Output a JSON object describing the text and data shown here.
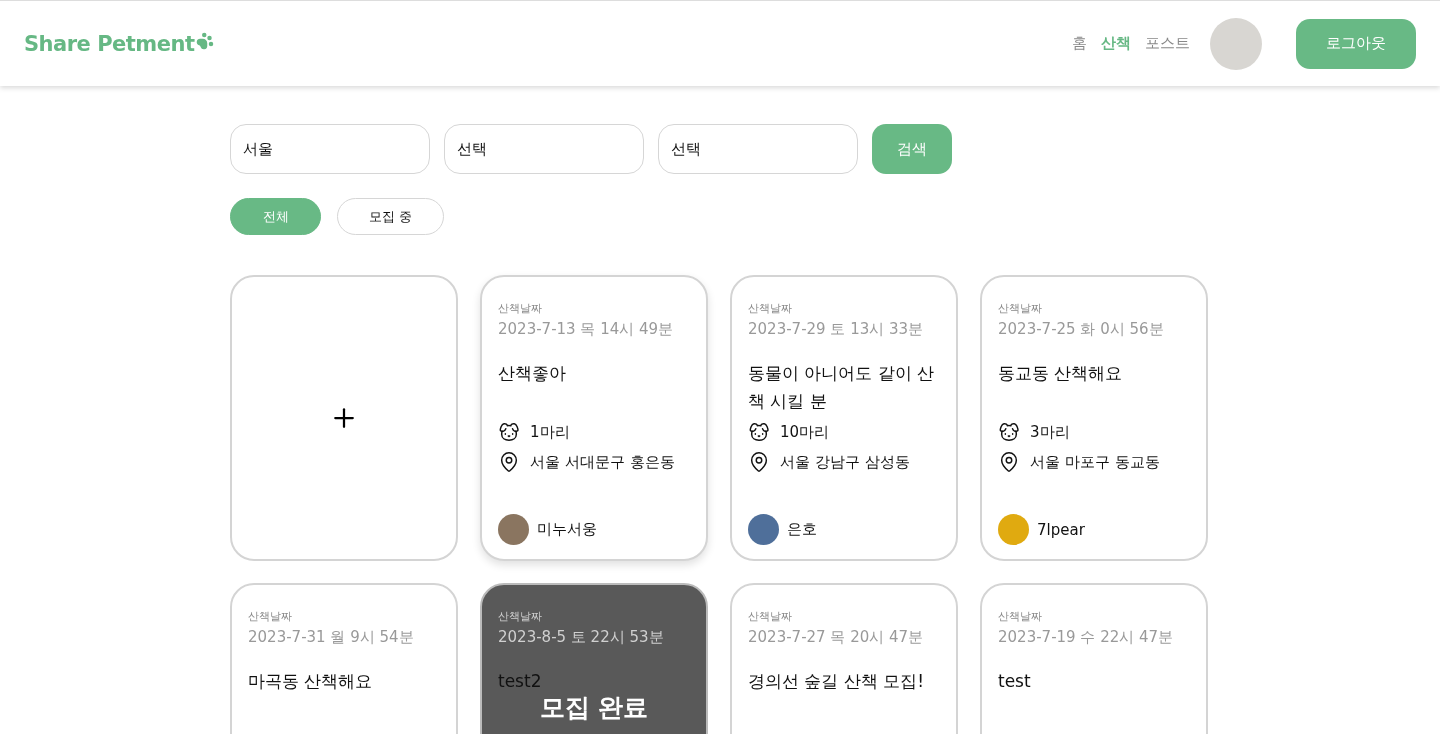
{
  "header": {
    "logo": "Share Petment",
    "nav": [
      {
        "label": "홈",
        "selected": false
      },
      {
        "label": "산책",
        "selected": true
      },
      {
        "label": "포스트",
        "selected": false
      }
    ],
    "logout": "로그아웃"
  },
  "search": {
    "selects": [
      {
        "value": "서울"
      },
      {
        "value": "선택"
      },
      {
        "value": "선택"
      }
    ],
    "button": "검색"
  },
  "filters": [
    {
      "label": "전체",
      "selected": true
    },
    {
      "label": "모집 중",
      "selected": false
    }
  ],
  "cards": [
    {
      "kind": "add"
    },
    {
      "kind": "post",
      "date_label": "산책날짜",
      "date": "2023-7-13 목 14시 49분",
      "title": "산책좋아",
      "dogs": "1마리",
      "location": "서울 서대문구 홍은동",
      "author": "미누서웅",
      "color": "#8a7560",
      "closed": false
    },
    {
      "kind": "post",
      "date_label": "산책날짜",
      "date": "2023-7-29 토 13시 33분",
      "title": "동물이 아니어도 같이 산책 시킬 분",
      "dogs": "10마리",
      "location": "서울 강남구 삼성동",
      "author": "은호",
      "color": "#4f6f9a",
      "closed": false
    },
    {
      "kind": "post",
      "date_label": "산책날짜",
      "date": "2023-7-25 화 0시 56분",
      "title": "동교동 산책해요",
      "dogs": "3마리",
      "location": "서울 마포구 동교동",
      "author": "7lpear",
      "color": "#e0aa10",
      "closed": false
    },
    {
      "kind": "post",
      "date_label": "산책날짜",
      "date": "2023-7-31 월 9시 54분",
      "title": "마곡동 산책해요",
      "closed": false
    },
    {
      "kind": "post",
      "date_label": "산책날짜",
      "date": "2023-8-5 토 22시 53분",
      "title": "test2",
      "closed": true,
      "closed_label": "모집 완료"
    },
    {
      "kind": "post",
      "date_label": "산책날짜",
      "date": "2023-7-27 목 20시 47분",
      "title": "경의선 숲길 산책 모집!",
      "closed": false
    },
    {
      "kind": "post",
      "date_label": "산책날짜",
      "date": "2023-7-19 수 22시 47분",
      "title": "test",
      "closed": false
    }
  ]
}
